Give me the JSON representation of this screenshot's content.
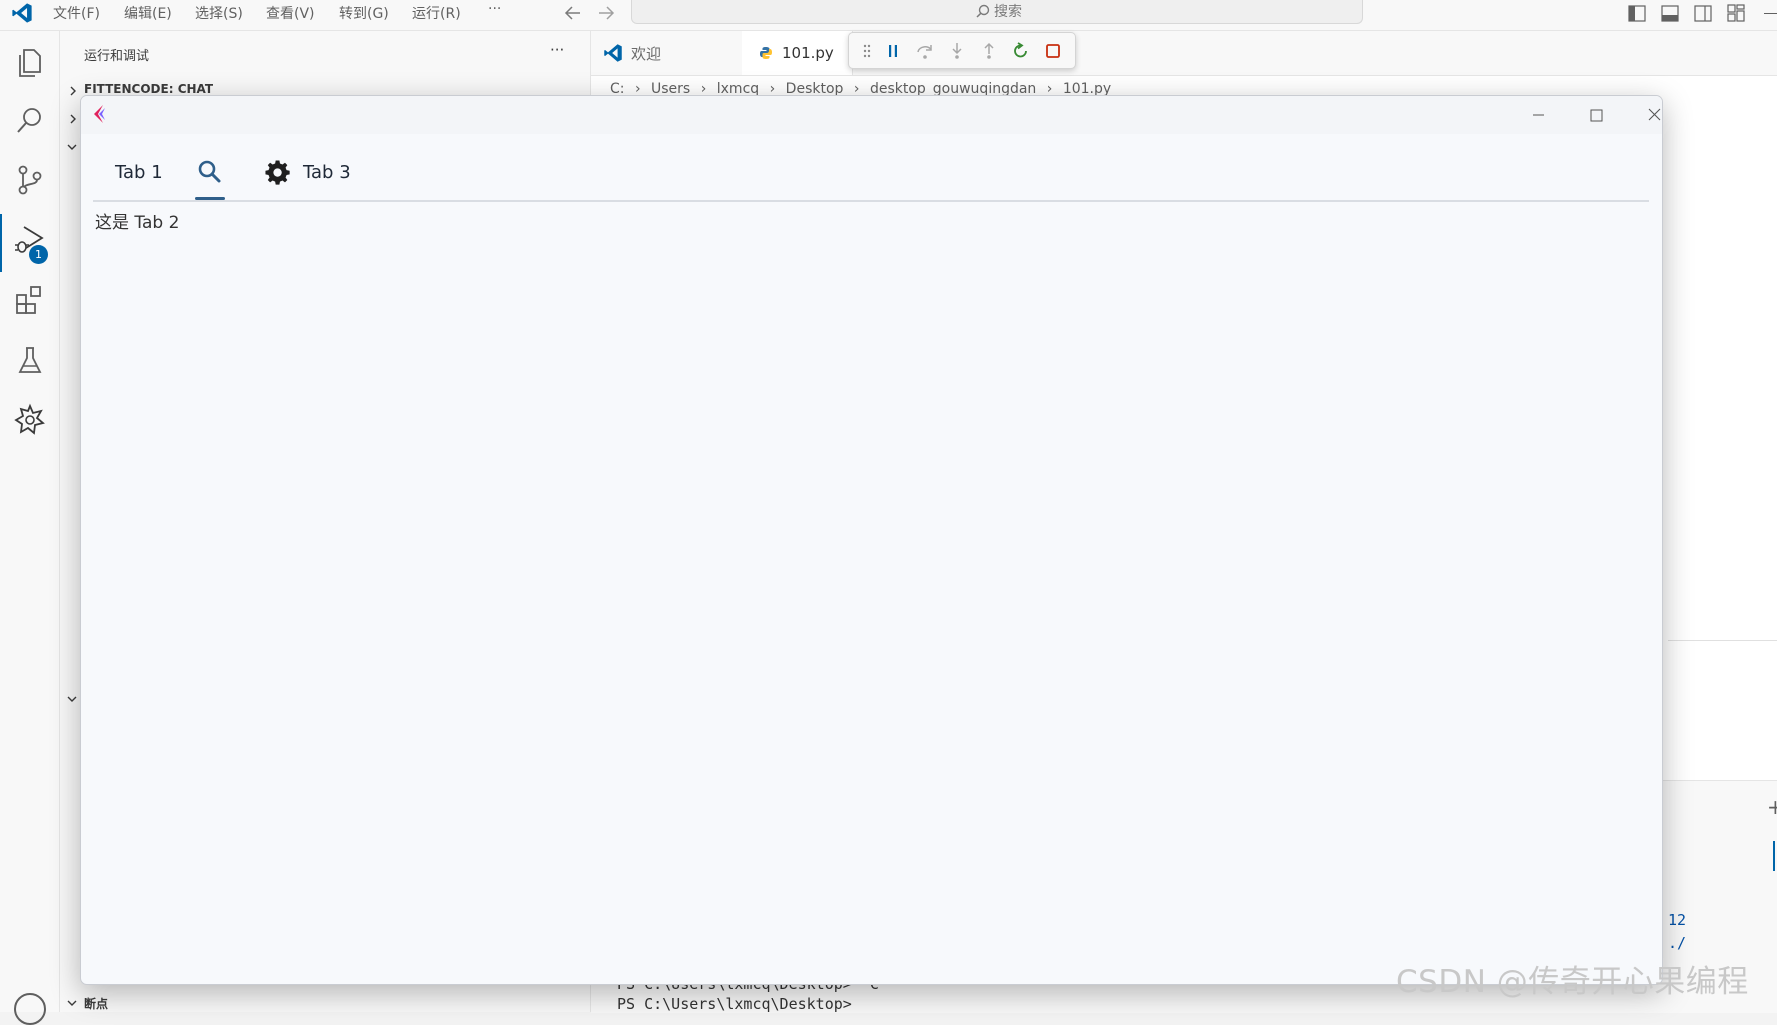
{
  "menu": [
    "文件(F)",
    "编辑(E)",
    "选择(S)",
    "查看(V)",
    "转到(G)",
    "运行(R)",
    "···"
  ],
  "search_placeholder": "搜索",
  "activity": {
    "debug_badge": "1"
  },
  "sidebar": {
    "title": "运行和调试",
    "more": "···",
    "section1": "FITTENCODE: CHAT",
    "breakpoints": "断点"
  },
  "editor": {
    "tabs": [
      "欢迎",
      "101.py"
    ],
    "breadcrumb": [
      "C:",
      "Users",
      "lxmcq",
      "Desktop",
      "desktop_gouwuqingdan",
      "101.py"
    ],
    "terminal_lines": [
      "PS C:\\Users\\lxmcq\\Desktop> ^C",
      "PS C:\\Users\\lxmcq\\Desktop>"
    ],
    "right_fragments": [
      "12",
      "./"
    ],
    "plus": "+"
  },
  "app_window": {
    "tabs": [
      {
        "label": "Tab 1",
        "icon": ""
      },
      {
        "label": "",
        "icon": "search-icon"
      },
      {
        "label": "Tab 3",
        "icon": "gear-icon"
      }
    ],
    "content": "这是 Tab 2"
  },
  "watermark": "CSDN @传奇开心果编程",
  "colors": {
    "accent": "#2f5f8a",
    "vscode_blue": "#0065a9",
    "restart_green": "#388a34",
    "stop_red": "#c72e0f"
  }
}
